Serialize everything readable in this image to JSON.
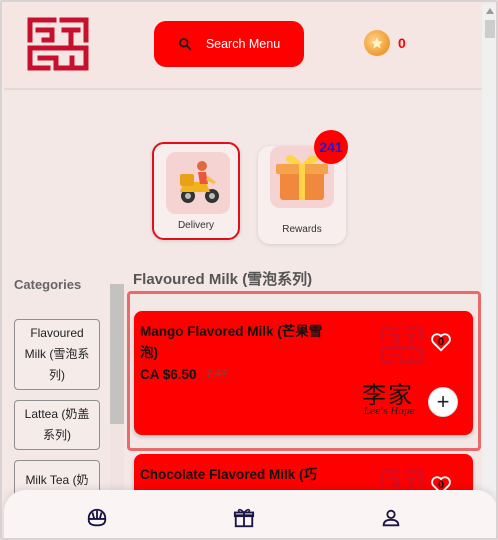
{
  "header": {
    "logo_icon": "lees-logo-icon",
    "search_label": "Search Menu",
    "coins": "0"
  },
  "tiles": {
    "delivery": {
      "label": "Delivery",
      "icon": "delivery-scooter-icon"
    },
    "rewards": {
      "label": "Rewards",
      "icon": "gift-box-icon",
      "badge": "241"
    }
  },
  "categories": {
    "title": "Categories",
    "items": [
      {
        "label": "Flavoured Milk (雪泡系列)"
      },
      {
        "label": "Lattea (奶盖系列)"
      },
      {
        "label": "Milk Tea (奶"
      }
    ]
  },
  "section": {
    "title": "Flavoured Milk (雪泡系列)"
  },
  "products": [
    {
      "name": "Mango Flavored Milk (芒果雪泡)",
      "price": "CA $6.50",
      "old_price": "7.47",
      "likes": "0",
      "brand_cn": "李家",
      "brand_en": "Lee's Hope"
    },
    {
      "name": "Chocolate Flavored Milk (巧",
      "likes": "0"
    }
  ],
  "colors": {
    "accent": "#ff0000",
    "badge_text": "#1b1bd4",
    "background": "#f4e8e7"
  },
  "bottom_nav": {
    "items": [
      {
        "icon": "menu-bowl-icon"
      },
      {
        "icon": "gift-icon"
      },
      {
        "icon": "user-icon"
      }
    ]
  }
}
